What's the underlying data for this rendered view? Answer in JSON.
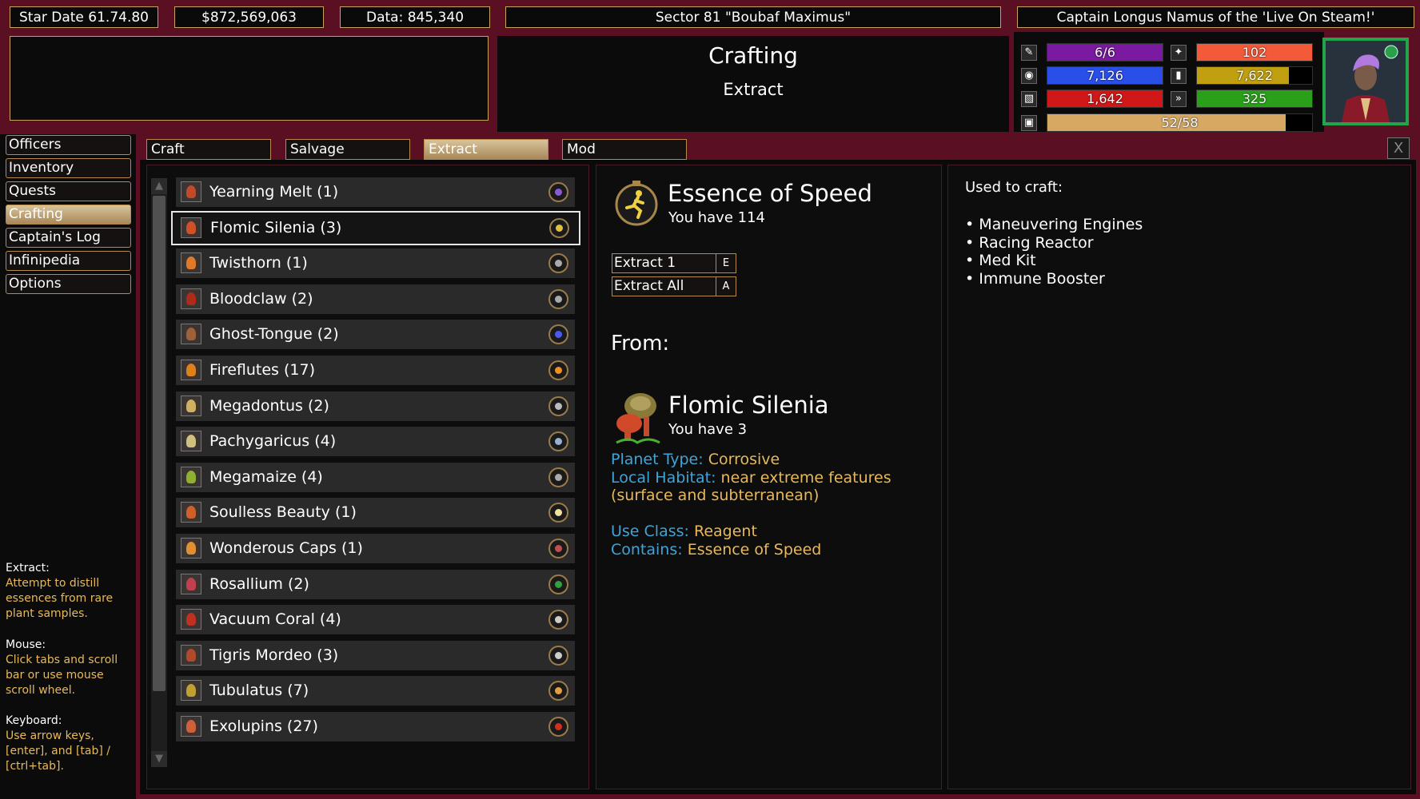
{
  "header": {
    "stardate": "Star Date 61.74.80",
    "money": "$872,569,063",
    "data": "Data: 845,340",
    "sector": "Sector 81 \"Boubaf Maximus\"",
    "captain": "Captain Longus Namus of the 'Live On Steam!'"
  },
  "title": {
    "main": "Crafting",
    "sub": "Extract"
  },
  "stats": [
    {
      "icon": "crew-icon",
      "text": "6/6",
      "color": "#7a1aa0",
      "level": 1.0
    },
    {
      "icon": "shield-icon",
      "text": "7,126",
      "color": "#2a4ee8",
      "level": 1.0
    },
    {
      "icon": "armor-icon",
      "text": "1,642",
      "color": "#d01818",
      "level": 1.0
    },
    {
      "icon": "fuel-icon",
      "text": "102",
      "color": "#f25a3a",
      "level": 1.0
    },
    {
      "icon": "supplies-icon",
      "text": "7,622",
      "color": "#c0a010",
      "level": 0.8
    },
    {
      "icon": "speed-icon",
      "text": "325",
      "color": "#2aa01a",
      "level": 1.0
    },
    {
      "icon": "cargo-icon",
      "text": "52/58",
      "color": "#d6a862",
      "level": 0.9
    }
  ],
  "nav": [
    {
      "label": "Officers",
      "active": false
    },
    {
      "label": "Inventory",
      "active": false
    },
    {
      "label": "Quests",
      "active": false
    },
    {
      "label": "Crafting",
      "active": true
    },
    {
      "label": "Captain's Log",
      "active": false
    },
    {
      "label": "Infinipedia",
      "active": false
    },
    {
      "label": "Options",
      "active": false
    }
  ],
  "tabs": [
    {
      "label": "Craft",
      "active": false
    },
    {
      "label": "Salvage",
      "active": false
    },
    {
      "label": "Extract",
      "active": true
    },
    {
      "label": "Mod",
      "active": false
    }
  ],
  "help": {
    "extract_h": "Extract:",
    "extract_b": "Attempt to distill essences from rare plant samples.",
    "mouse_h": "Mouse:",
    "mouse_b": "Click tabs and scroll bar or use mouse scroll wheel.",
    "keyboard_h": "Keyboard:",
    "keyboard_b": "Use arrow keys, [enter], and [tab] / [ctrl+tab]."
  },
  "close": "X",
  "plants": [
    {
      "name": "Yearning Melt (1)",
      "color": "#c04a2a",
      "essence": "#8a5ad0"
    },
    {
      "name": "Flomic Silenia (3)",
      "color": "#d0502a",
      "essence": "#e0c040",
      "selected": true
    },
    {
      "name": "Twisthorn (1)",
      "color": "#e07a2a",
      "essence": "#aaaaaa"
    },
    {
      "name": "Bloodclaw (2)",
      "color": "#b02a1a",
      "essence": "#aaaaaa"
    },
    {
      "name": "Ghost-Tongue (2)",
      "color": "#a0603a",
      "essence": "#4a5af0"
    },
    {
      "name": "Fireflutes (17)",
      "color": "#e0801a",
      "essence": "#f09020"
    },
    {
      "name": "Megadontus (2)",
      "color": "#d0b060",
      "essence": "#bbbbbb"
    },
    {
      "name": "Pachygaricus (4)",
      "color": "#d0c080",
      "essence": "#9ab0d0"
    },
    {
      "name": "Megamaize (4)",
      "color": "#90b030",
      "essence": "#aaaaaa"
    },
    {
      "name": "Soulless Beauty (1)",
      "color": "#d0602a",
      "essence": "#f0e0a0"
    },
    {
      "name": "Wonderous Caps (1)",
      "color": "#e09030",
      "essence": "#c05050"
    },
    {
      "name": "Rosallium (2)",
      "color": "#c04050",
      "essence": "#30a040"
    },
    {
      "name": "Vacuum Coral (4)",
      "color": "#c03020",
      "essence": "#cccccc"
    },
    {
      "name": "Tigris Mordeo (3)",
      "color": "#b04a2a",
      "essence": "#cccccc"
    },
    {
      "name": "Tubulatus (7)",
      "color": "#c0a030",
      "essence": "#e0a040"
    },
    {
      "name": "Exolupins (27)",
      "color": "#d0603a",
      "essence": "#d03020"
    }
  ],
  "detail": {
    "essence_name": "Essence of Speed",
    "essence_have": "You have 114",
    "extract1": "Extract 1",
    "extract1_key": "E",
    "extractall": "Extract All",
    "extractall_key": "A",
    "from": "From:",
    "plant_name": "Flomic Silenia",
    "plant_have": "You have 3",
    "planet_type_l": "Planet Type:",
    "planet_type_v": "Corrosive",
    "habitat_l": "Local Habitat:",
    "habitat_v": "near extreme features",
    "habitat_v2": "(surface and subterranean)",
    "useclass_l": "Use Class:",
    "useclass_v": "Reagent",
    "contains_l": "Contains:",
    "contains_v": "Essence of Speed"
  },
  "used": {
    "title": "Used to craft:",
    "items": [
      "• Maneuvering Engines",
      "• Racing Reactor",
      "• Med Kit",
      "• Immune Booster"
    ]
  }
}
